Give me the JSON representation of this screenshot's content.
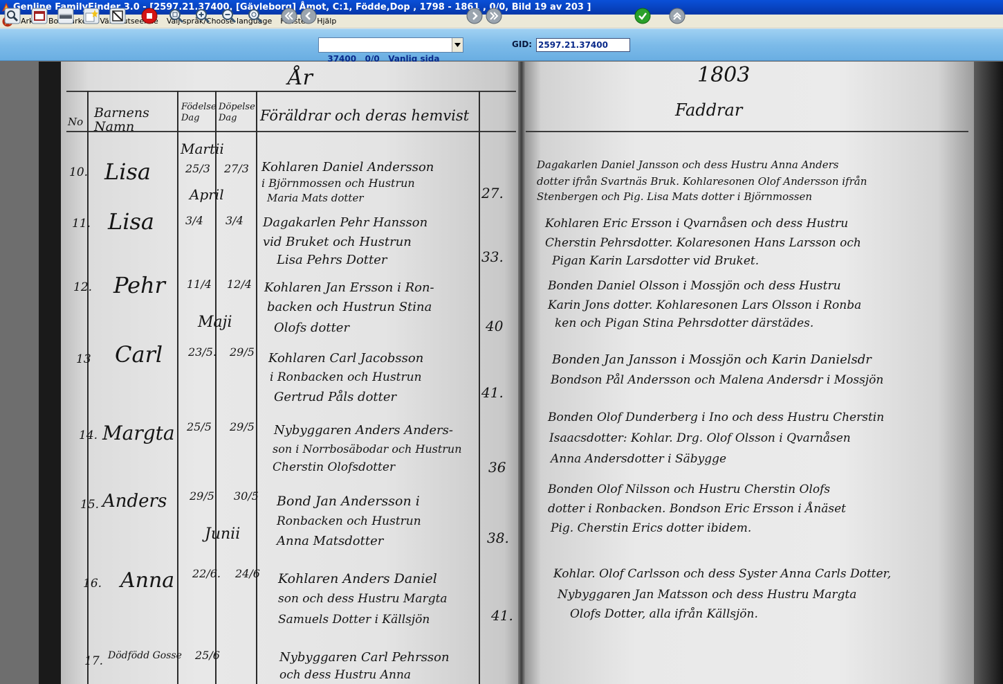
{
  "window": {
    "title": "Genline FamilyFinder 3.0 - [2597.21.37400,  [Gävleborg]  Åmot,  C:1,  Födde,Dop ,  1798 - 1861 ,  0/0,  Bild 19 av 203  ]"
  },
  "menu": {
    "items": [
      "Arkiv",
      "Bokmärken",
      "Växla utseende",
      "Välj språk/Choose language",
      "Fönster",
      "Hjälp"
    ]
  },
  "toolbar": {
    "page_select_value": "37400   0/0   Vanlig sida",
    "gid_label": "GID:",
    "gid_value": "2597.21.37400"
  },
  "document": {
    "left_header": "År",
    "right_header": "1803",
    "col_nr": "No",
    "col_names": "Barnens Namn",
    "col_born": "Födelse Dag",
    "col_baptized": "Döpelse Dag",
    "col_parents": "Föräldrar och deras hemvist",
    "col_godparents": "Faddrar",
    "months": [
      "Martii",
      "April",
      "Maji",
      "Junii"
    ],
    "entries": [
      {
        "nr": "10.",
        "name": "Lisa",
        "born": "25/3",
        "bapt": "27/3",
        "parents": [
          "Kohlaren Daniel Andersson",
          "i Björnmossen och Hustrun",
          "Maria Mats dotter"
        ],
        "age": "27.",
        "godparents": [
          "Dagakarlen Daniel Jansson och dess Hustru Anna Anders",
          "dotter ifrån Svartnäs Bruk. Kohlaresonen Olof Andersson ifrån",
          "Stenbergen och Pig. Lisa Mats dotter i Björnmossen"
        ]
      },
      {
        "nr": "11.",
        "name": "Lisa",
        "born": "3/4",
        "bapt": "3/4",
        "parents": [
          "Dagakarlen Pehr Hansson",
          "vid Bruket och Hustrun",
          "Lisa Pehrs Dotter"
        ],
        "age": "33.",
        "godparents": [
          "Kohlaren Eric Ersson i Qvarnåsen och dess Hustru",
          "Cherstin Pehrsdotter. Kolaresonen Hans Larsson och",
          "Pigan Karin Larsdotter vid Bruket."
        ]
      },
      {
        "nr": "12.",
        "name": "Pehr",
        "born": "11/4",
        "bapt": "12/4",
        "parents": [
          "Kohlaren Jan Ersson i Ron-",
          "backen och Hustrun Stina",
          "Olofs dotter"
        ],
        "age": "40",
        "godparents": [
          "Bonden Daniel Olsson i Mossjön och dess Hustru",
          "Karin Jons dotter. Kohlaresonen Lars Olsson i Ronba",
          "ken och Pigan Stina Pehrsdotter därstädes."
        ]
      },
      {
        "nr": "13",
        "name": "Carl",
        "born": "23/5.",
        "bapt": "29/5",
        "parents": [
          "Kohlaren Carl Jacobsson",
          "i Ronbacken och Hustrun",
          "Gertrud Påls dotter"
        ],
        "age": "41.",
        "godparents": [
          "Bonden Jan Jansson i Mossjön och Karin Danielsdr",
          "Bondson Pål Andersson och Malena Andersdr i Mossjön"
        ]
      },
      {
        "nr": "14.",
        "name": "Margta",
        "born": "25/5",
        "bapt": "29/5",
        "parents": [
          "Nybyggaren Anders Anders-",
          "son i Norrbosäbodar och Hustrun",
          "Cherstin Olofsdotter"
        ],
        "age": "36",
        "godparents": [
          "Bonden Olof Dunderberg i Ino och dess Hustru Cherstin",
          "Isaacsdotter: Kohlar. Drg. Olof Olsson i Qvarnåsen",
          "Anna Andersdotter i Säbygge"
        ]
      },
      {
        "nr": "15.",
        "name": "Anders",
        "born": "29/5",
        "bapt": "30/5",
        "parents": [
          "Bond Jan Andersson i",
          "Ronbacken och Hustrun",
          "Anna Matsdotter"
        ],
        "age": "38.",
        "godparents": [
          "Bonden Olof Nilsson och Hustru Cherstin Olofs",
          "dotter i Ronbacken. Bondson Eric Ersson i Ånäset",
          "Pig. Cherstin Erics dotter ibidem."
        ]
      },
      {
        "nr": "16.",
        "name": "Anna",
        "born": "22/6.",
        "bapt": "24/6",
        "parents": [
          "Kohlaren Anders Daniel",
          "son och dess Hustru Margta",
          "Samuels Dotter i Källsjön"
        ],
        "age": "41.",
        "godparents": [
          "Kohlar. Olof Carlsson och dess Syster Anna Carls Dotter,",
          "Nybyggaren Jan Matsson och dess Hustru Margta",
          "Olofs Dotter, alla ifrån Källsjön."
        ]
      },
      {
        "nr": "17.",
        "name": "Dödfödd Gosse",
        "born": "25/6",
        "bapt": "",
        "parents": [
          "Nybyggaren Carl Pehrsson",
          "och dess Hustru Anna"
        ],
        "age": "",
        "godparents": []
      }
    ]
  },
  "colors": {
    "title_bg": "#0845c4",
    "menu_bg": "#ece9d8",
    "toolbar_bg": "#7cbbe9",
    "viewer_bg": "#1a1a1a",
    "paper": "#e6e6e6",
    "ink": "#141414"
  },
  "icons": [
    "search-icon",
    "window-icon",
    "scanner-icon",
    "star-icon",
    "crop-icon",
    "stop-icon",
    "zoom-fit-icon",
    "zoom-in-icon",
    "zoom-out-icon",
    "zoom-reset-icon",
    "first-page-icon",
    "prev-page-icon",
    "next-page-icon",
    "last-page-icon",
    "go-icon",
    "collapse-icon"
  ]
}
